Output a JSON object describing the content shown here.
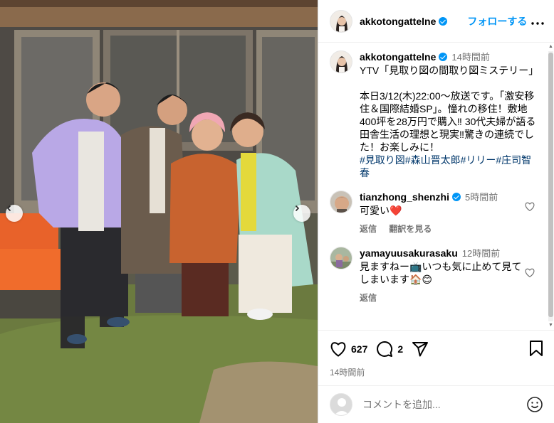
{
  "post": {
    "username": "akkotongattelne",
    "follow_label": "フォローする",
    "more_label": "•••",
    "caption_time": "14時間前",
    "caption_text": "YTV「見取り図の間取り図ミステリー」\n\n本日3/12(木)22:00～放送です。「激安移住＆国際結婚SP」。憧れの移住！敷地400坪を28万円で購入‼︎ 30代夫婦が語る田舎生活の理想と現実‼︎驚きの連続でした！お楽しみに！",
    "hashtags": "#見取り図#森山晋太郎#リリー#庄司智春",
    "likes": "627",
    "comments_count": "2",
    "post_time": "14時間前"
  },
  "comments": [
    {
      "username": "tianzhong_shenzhi",
      "verified": true,
      "time": "5時間前",
      "text": "可愛い❤️",
      "reply_label": "返信",
      "translate_label": "翻訳を見る"
    },
    {
      "username": "yamayuusakurasaku",
      "verified": false,
      "time": "12時間前",
      "text": "見ますねー📺いつも気に止めて見てしまいます🏠😊",
      "reply_label": "返信"
    }
  ],
  "add_comment": {
    "placeholder": "コメントを追加..."
  },
  "icons": {
    "prev": "chevron-left-icon",
    "next": "chevron-right-icon",
    "like": "heart-icon",
    "comment": "comment-bubble-icon",
    "share": "paper-plane-icon",
    "save": "bookmark-icon",
    "emoji": "smiley-icon"
  },
  "colors": {
    "link": "#0095f6",
    "hashtag": "#00376b",
    "muted": "#737373",
    "verified": "#0095f6"
  }
}
